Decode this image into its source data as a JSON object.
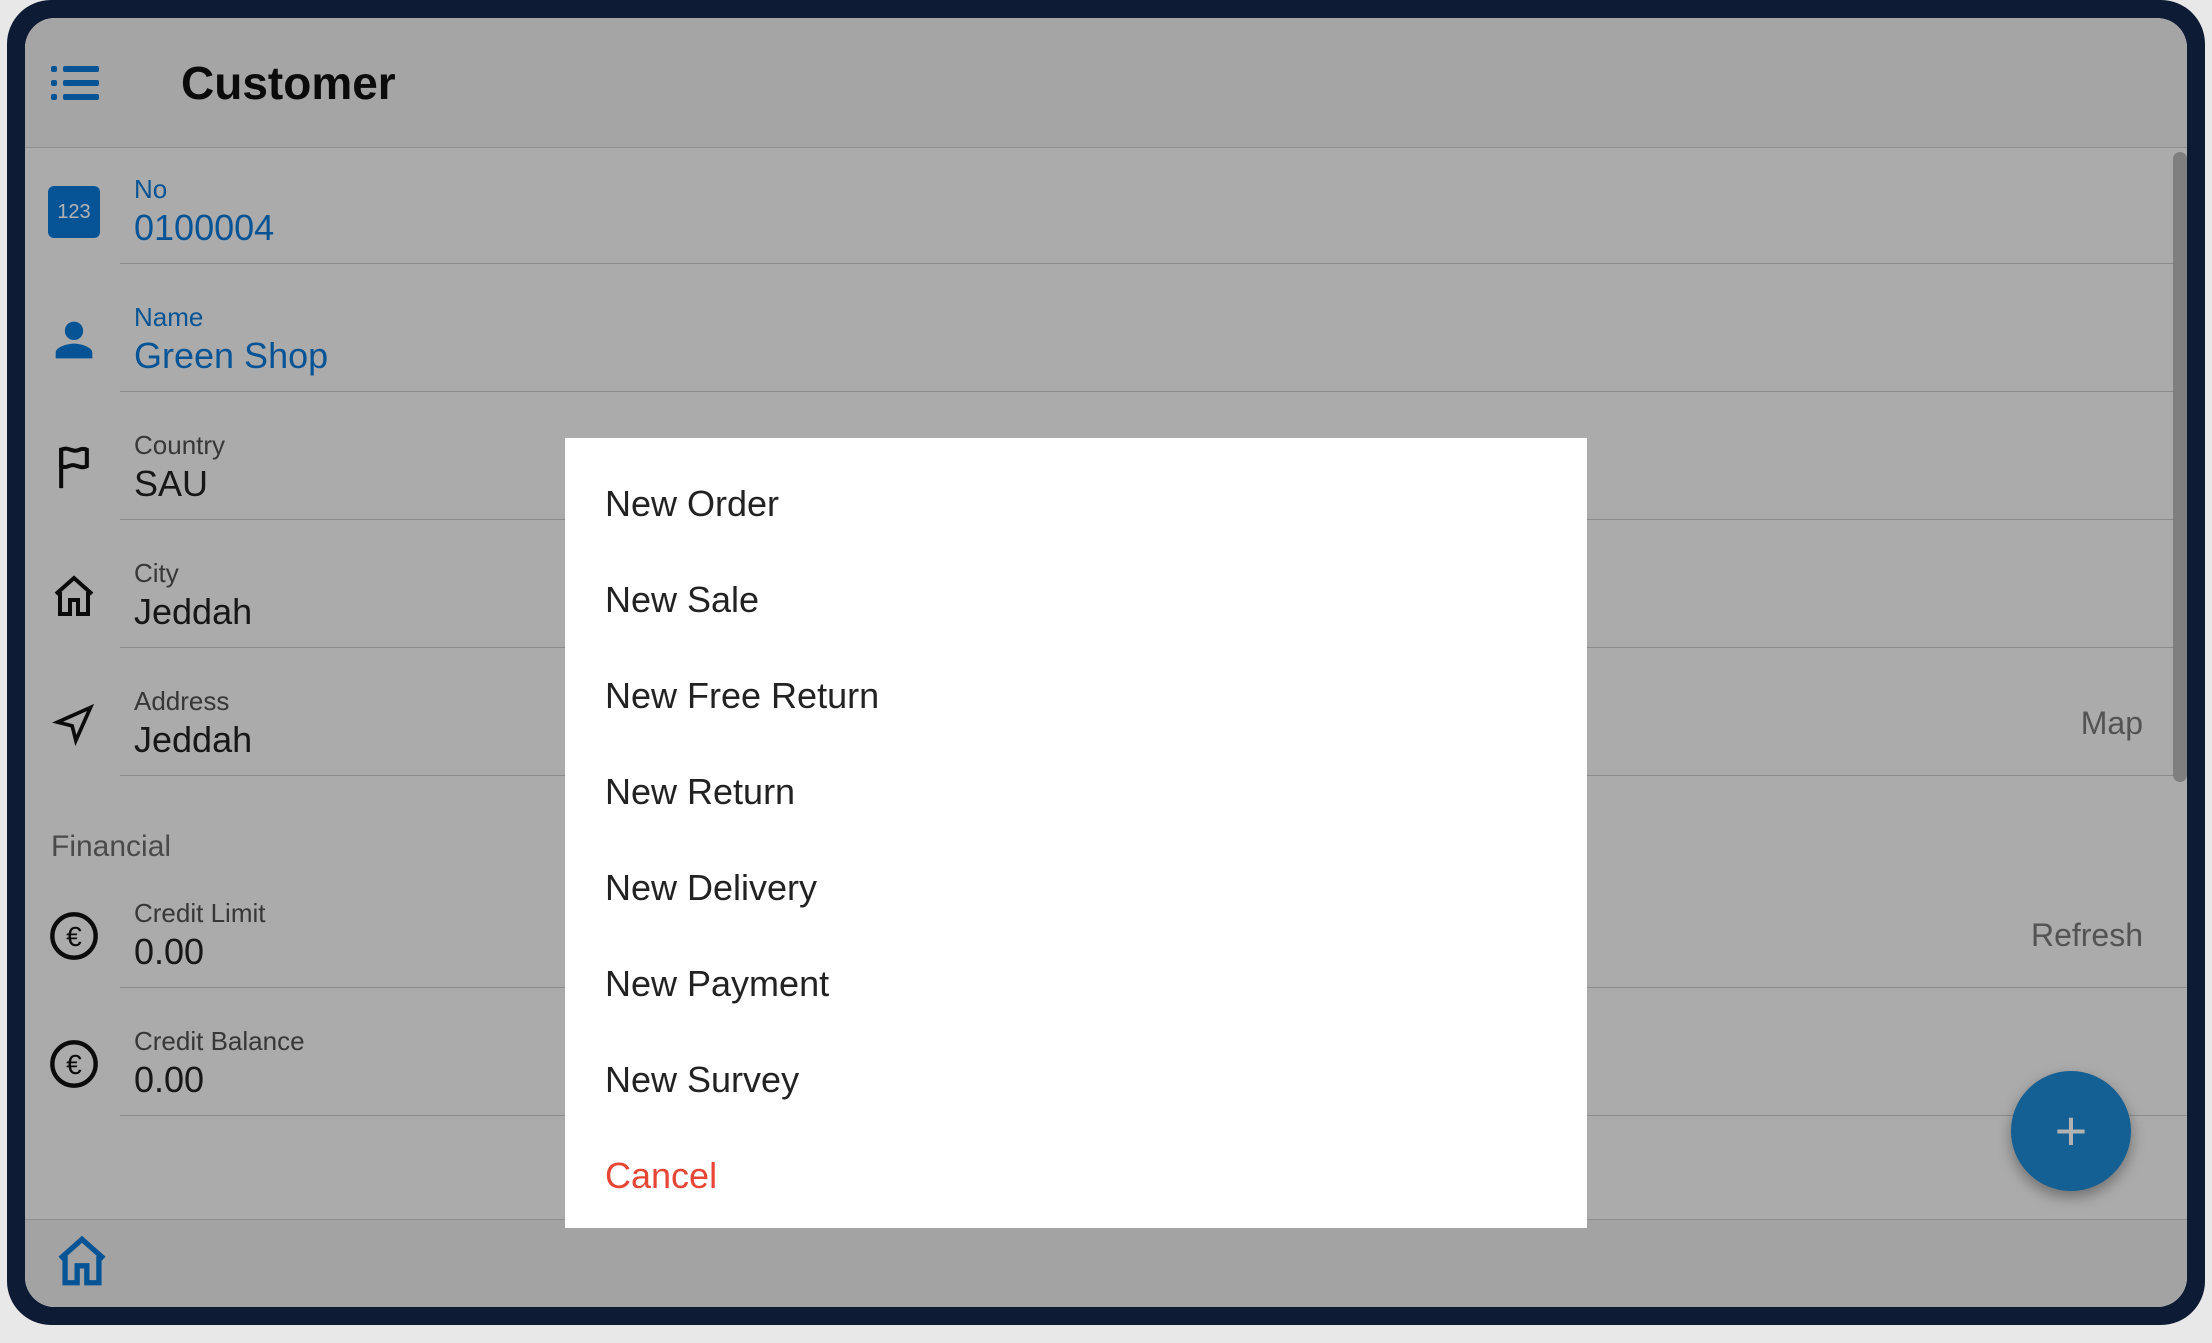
{
  "header": {
    "title": "Customer"
  },
  "customer": {
    "no_label": "No",
    "no": "0100004",
    "name_label": "Name",
    "name": "Green Shop",
    "country_label": "Country",
    "country": "SAU",
    "city_label": "City",
    "city": "Jeddah",
    "address_label": "Address",
    "address": "Jeddah",
    "map_action": "Map"
  },
  "financial": {
    "section_title": "Financial",
    "credit_limit_label": "Credit Limit",
    "credit_limit": "0.00",
    "credit_balance_label": "Credit Balance",
    "credit_balance": "0.00",
    "refresh_action": "Refresh"
  },
  "id_badge": "123",
  "menu": {
    "items": [
      "New Order",
      "New Sale",
      "New Free Return",
      "New Return",
      "New Delivery",
      "New Payment",
      "New Survey"
    ],
    "cancel": "Cancel"
  },
  "colors": {
    "primary": "#0a79d7",
    "device": "#0d1b35",
    "danger": "#e74635"
  }
}
